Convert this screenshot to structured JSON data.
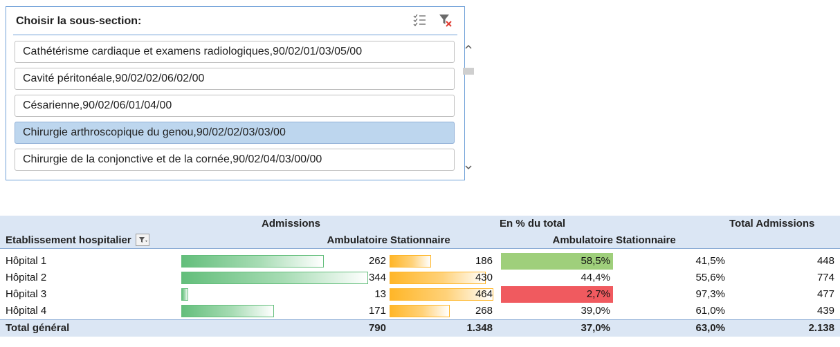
{
  "slicer": {
    "title": "Choisir la sous-section:",
    "multi_select_icon": "multi-select-icon",
    "clear_filter_icon": "clear-filter-icon",
    "items": [
      {
        "label": "Cathétérisme cardiaque et examens radiologiques,90/02/01/03/05/00",
        "selected": false
      },
      {
        "label": "Cavité péritonéale,90/02/02/06/02/00",
        "selected": false
      },
      {
        "label": "Césarienne,90/02/06/01/04/00",
        "selected": false
      },
      {
        "label": "Chirurgie arthroscopique du genou,90/02/02/03/03/00",
        "selected": true
      },
      {
        "label": "Chirurgie de la conjonctive et de la cornée,90/02/04/03/00/00",
        "selected": false
      }
    ],
    "scroll_up": "^",
    "scroll_down": "⌄"
  },
  "pivot": {
    "header1": {
      "admissions": "Admissions",
      "pct_total": "En % du total",
      "total_admissions": "Total Admissions"
    },
    "header2": {
      "row_label": "Etablissement hospitalier",
      "ambulatoire": "Ambulatoire",
      "stationnaire": "Stationnaire",
      "pct_ambulatoire": "Ambulatoire",
      "pct_stationnaire": "Stationnaire"
    },
    "rows": [
      {
        "name": "Hôpital 1",
        "amb": "262",
        "stat": "186",
        "pct_amb": "58,5%",
        "pct_stat": "41,5%",
        "total": "448",
        "amb_value": 262,
        "stat_value": 186,
        "pct_color": "#9fcf7b"
      },
      {
        "name": "Hôpital 2",
        "amb": "344",
        "stat": "430",
        "pct_amb": "44,4%",
        "pct_stat": "55,6%",
        "total": "774",
        "amb_value": 344,
        "stat_value": 430,
        "pct_color": ""
      },
      {
        "name": "Hôpital 3",
        "amb": "13",
        "stat": "464",
        "pct_amb": "2,7%",
        "pct_stat": "97,3%",
        "total": "477",
        "amb_value": 13,
        "stat_value": 464,
        "pct_color": "#f05a5f"
      },
      {
        "name": "Hôpital 4",
        "amb": "171",
        "stat": "268",
        "pct_amb": "39,0%",
        "pct_stat": "61,0%",
        "total": "439",
        "amb_value": 171,
        "stat_value": 268,
        "pct_color": ""
      }
    ],
    "total": {
      "name": "Total général",
      "amb": "790",
      "stat": "1.348",
      "pct_amb": "37,0%",
      "pct_stat": "63,0%",
      "total": "2.138"
    },
    "colors": {
      "header_bg": "#dbe6f4",
      "bar_green": "#63be7b",
      "bar_orange": "#ffb628"
    }
  }
}
